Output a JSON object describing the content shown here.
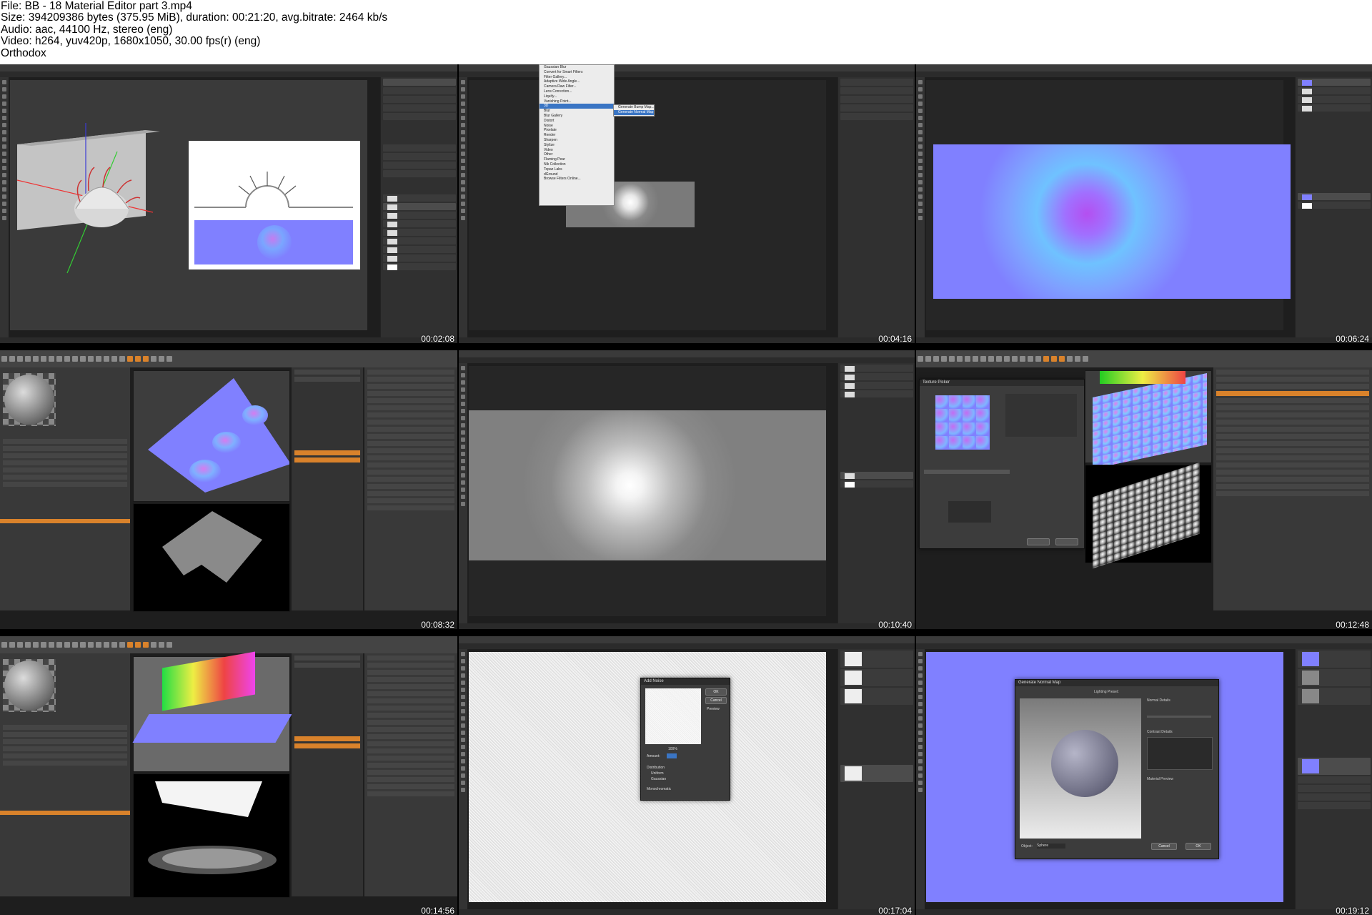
{
  "header": {
    "lines": [
      "File: BB - 18 Material Editor part 3.mp4",
      "Size: 394209386 bytes (375.95 MiB), duration: 00:21:20, avg.bitrate: 2464 kb/s",
      "Audio: aac, 44100 Hz, stereo (eng)",
      "Video: h264, yuv420p, 1680x1050, 30.00 fps(r) (eng)",
      "Orthodox"
    ]
  },
  "thumbnails": [
    {
      "timestamp": "00:02:08",
      "app": "photoshop"
    },
    {
      "timestamp": "00:04:16",
      "app": "photoshop"
    },
    {
      "timestamp": "00:06:24",
      "app": "photoshop"
    },
    {
      "timestamp": "00:08:32",
      "app": "maya"
    },
    {
      "timestamp": "00:10:40",
      "app": "photoshop"
    },
    {
      "timestamp": "00:12:48",
      "app": "maya"
    },
    {
      "timestamp": "00:14:56",
      "app": "maya"
    },
    {
      "timestamp": "00:17:04",
      "app": "photoshop"
    },
    {
      "timestamp": "00:19:12",
      "app": "photoshop"
    }
  ],
  "filter_menu": {
    "items": [
      "Gaussian Blur",
      "Convert for Smart Filters",
      "Filter Gallery...",
      "Adaptive Wide Angle...",
      "Camera Raw Filter...",
      "Lens Correction...",
      "Liquify...",
      "Vanishing Point...",
      "3D",
      "Blur",
      "Blur Gallery",
      "Distort",
      "Noise",
      "Pixelate",
      "Render",
      "Sharpen",
      "Stylize",
      "Video",
      "Other",
      "Flaming Pear",
      "Nik Collection",
      "Topaz Labs",
      "dGround",
      "Browse Filters Online..."
    ],
    "submenu": [
      "Generate Bump Map...",
      "Generate Normal Map..."
    ]
  },
  "add_noise": {
    "title": "Add Noise",
    "ok": "OK",
    "cancel": "Cancel",
    "preview": "Preview",
    "zoom": "100%",
    "amount_label": "Amount:",
    "distribution_label": "Distribution",
    "uniform": "Uniform",
    "gaussian": "Gaussian",
    "monochromatic": "Monochromatic"
  },
  "normal_map_dialog": {
    "title": "Generate Normal Map",
    "lighting_label": "Lighting Preset:",
    "normal_details": "Normal Details",
    "contrast_details": "Contrast Details",
    "material_preview": "Material Preview",
    "object_label": "Object:",
    "object_value": "Sphere",
    "cancel": "Cancel",
    "ok": "OK"
  },
  "texture_picker": {
    "title": "Texture Picker"
  },
  "colors": {
    "normal_blue": "#8080ff",
    "menu_highlight": "#3a75c4",
    "maya_orange": "#d9822b"
  }
}
